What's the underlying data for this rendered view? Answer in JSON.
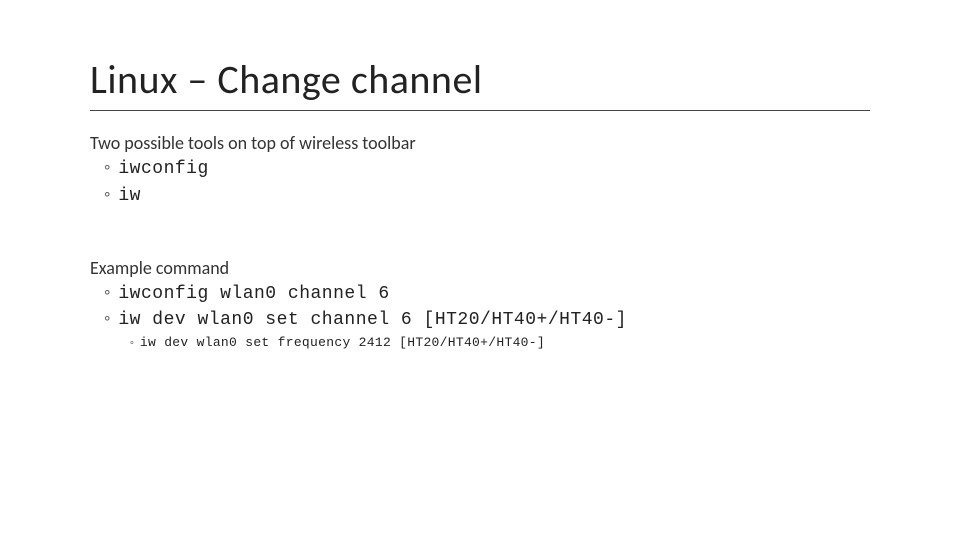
{
  "title": "Linux – Change channel",
  "section1": {
    "heading": "Two possible tools on top of wireless toolbar",
    "items": [
      "iwconfig",
      "iw"
    ]
  },
  "section2": {
    "heading": "Example command",
    "items": [
      "iwconfig wlan0 channel 6",
      "iw dev wlan0 set channel 6 [HT20/HT40+/HT40-]"
    ],
    "subitems": [
      "iw dev wlan0 set frequency 2412 [HT20/HT40+/HT40-]"
    ]
  }
}
